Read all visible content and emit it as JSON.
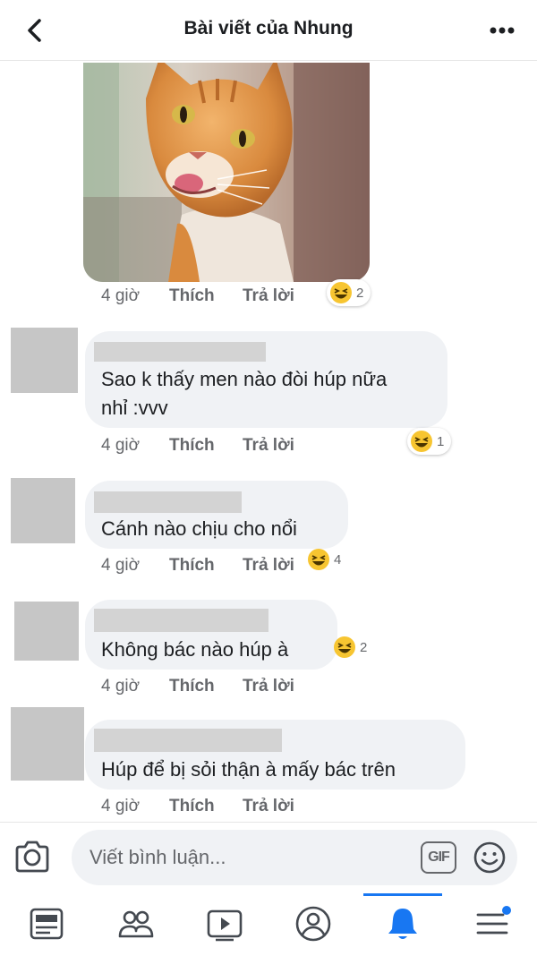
{
  "header": {
    "title": "Bài viết của Nhung",
    "back_icon": "chevron-left-icon",
    "more_icon": "more-horizontal-icon"
  },
  "post": {
    "image": "cat-licking-lips-photo",
    "time": "4 giờ",
    "like_label": "Thích",
    "reply_label": "Trả lời",
    "reaction": {
      "icon": "haha-emoji-icon",
      "count": "2"
    }
  },
  "comments": [
    {
      "text_lines": [
        "Sao k thấy men nào đòi húp nữa",
        "nhỉ :vvv"
      ],
      "time": "4 giờ",
      "like_label": "Thích",
      "reply_label": "Trả lời",
      "reaction": {
        "icon": "haha-emoji-icon",
        "count": "1"
      }
    },
    {
      "text_lines": [
        "Cánh nào chịu cho nổi"
      ],
      "time": "4 giờ",
      "like_label": "Thích",
      "reply_label": "Trả lời",
      "reaction": {
        "icon": "haha-emoji-icon",
        "count": "4"
      }
    },
    {
      "text_lines": [
        "Không bác nào húp à"
      ],
      "time": "4 giờ",
      "like_label": "Thích",
      "reply_label": "Trả lời",
      "reaction": {
        "icon": "haha-emoji-icon",
        "count": "2"
      }
    },
    {
      "text_lines": [
        "Húp để bị sỏi thận à mấy bác trên"
      ],
      "time": "4 giờ",
      "like_label": "Thích",
      "reply_label": "Trả lời"
    }
  ],
  "composer": {
    "placeholder": "Viết bình luận...",
    "gif_label": "GIF",
    "camera_icon": "camera-icon",
    "emoji_icon": "smiley-icon"
  },
  "tabbar": {
    "tabs": [
      "news-feed-icon",
      "groups-icon",
      "watch-video-icon",
      "profile-icon",
      "notifications-bell-icon",
      "menu-hamburger-icon"
    ],
    "active": "notifications-bell-icon",
    "accent_color": "#1877f2"
  },
  "colors": {
    "accent": "#1877f2",
    "bubble": "#f0f2f5",
    "muted_text": "#65676b"
  }
}
